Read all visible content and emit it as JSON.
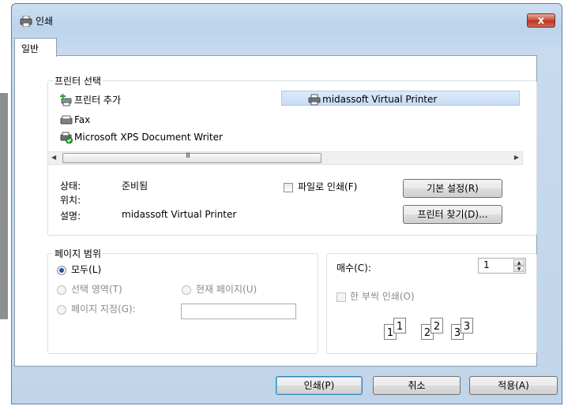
{
  "window": {
    "title": "인쇄",
    "close": "x"
  },
  "tabs": [
    {
      "label": "일반"
    }
  ],
  "printer_group": {
    "legend": "프린터 선택",
    "printers": [
      {
        "name": "프린터 추가"
      },
      {
        "name": "midassoft Virtual Printer",
        "selected": true
      },
      {
        "name": "Fax"
      },
      {
        "name": "Microsoft XPS Document Writer"
      }
    ],
    "status_label": "상태:",
    "status_value": "준비됨",
    "location_label": "위치:",
    "comment_label": "설명:",
    "comment_value": "midassoft Virtual Printer",
    "print_to_file": "파일로 인쇄(F)",
    "preferences_button": "기본 설정(R)",
    "find_printer_button": "프린터 찾기(D)..."
  },
  "page_range": {
    "legend": "페이지 범위",
    "all": "모두(L)",
    "selection": "선택 영역(T)",
    "current_page": "현재 페이지(U)",
    "pages": "페이지 지정(G):",
    "pages_value": ""
  },
  "copies": {
    "label": "매수(C):",
    "value": "1",
    "collate": "한 부씩 인쇄(O)",
    "collate_pages": [
      "1",
      "1",
      "2",
      "2",
      "3",
      "3"
    ]
  },
  "buttons": {
    "print": "인쇄(P)",
    "cancel": "취소",
    "apply": "적용(A)"
  },
  "scrollbar": {
    "grip": "III"
  }
}
